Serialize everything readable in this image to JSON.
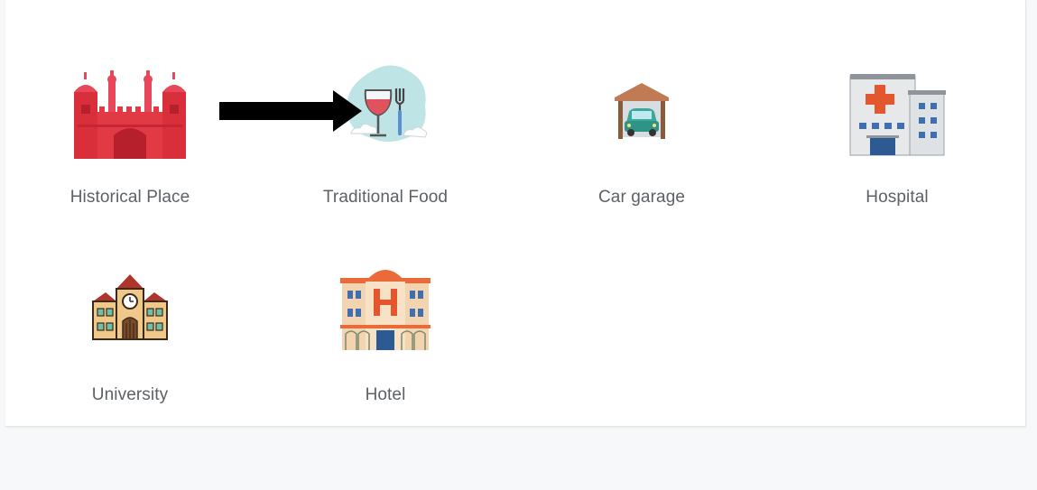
{
  "categories": [
    {
      "label": "Historical Place",
      "icon": "historical-place-icon"
    },
    {
      "label": "Traditional Food",
      "icon": "traditional-food-icon"
    },
    {
      "label": "Car garage",
      "icon": "car-garage-icon"
    },
    {
      "label": "Hospital",
      "icon": "hospital-icon"
    },
    {
      "label": "University",
      "icon": "university-icon"
    },
    {
      "label": "Hotel",
      "icon": "hotel-icon"
    }
  ],
  "annotation": {
    "icon": "black-arrow-icon",
    "color": "#000000"
  },
  "colors": {
    "card_background": "#ffffff",
    "page_background": "#f7f8f9",
    "label_text": "#5d6166",
    "fort_red": "#e23a45",
    "wine_red": "#e0525e",
    "hotel_orange": "#ea6a3a"
  }
}
